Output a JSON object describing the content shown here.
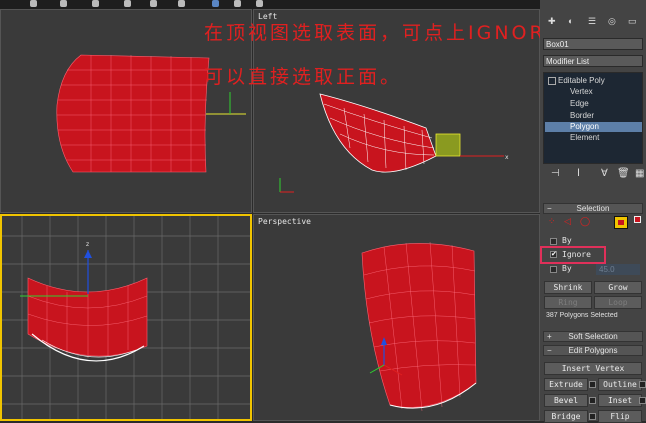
{
  "annotation": {
    "line1": "在顶视图选取表面，可点上IGNORE，",
    "line2": "可以直接选取正面。"
  },
  "viewports": {
    "top_right_label": "Left",
    "perspective_label": "Perspective"
  },
  "panel": {
    "object_name": "Box01",
    "modifier_list": "Modifier List",
    "stack": {
      "root": "Editable Poly",
      "items": [
        "Vertex",
        "Edge",
        "Border",
        "Polygon",
        "Element"
      ],
      "selected": "Polygon"
    },
    "selection": {
      "title": "Selection",
      "by_vertex": "By",
      "ignore": "Ignore",
      "by_angle": "By",
      "angle_value": "45.0",
      "shrink": "Shrink",
      "grow": "Grow",
      "ring": "Ring",
      "loop": "Loop",
      "status": "387 Polygons Selected"
    },
    "soft_selection": "Soft Selection",
    "edit_polygons": {
      "title": "Edit Polygons",
      "insert_vertex": "Insert Vertex",
      "extrude": "Extrude",
      "outline": "Outline",
      "bevel": "Bevel",
      "inset": "Inset",
      "bridge": "Bridge",
      "flip": "Flip"
    }
  },
  "colors": {
    "mesh": "#c8141e",
    "wire": "#ffffff",
    "annotation": "#e02020",
    "highlight_box": "#e0305a",
    "active_border": "#f0c400"
  }
}
